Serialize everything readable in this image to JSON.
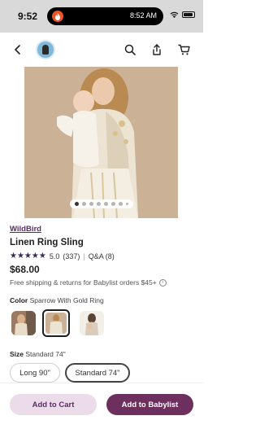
{
  "status_bar": {
    "time": "9:52",
    "island_time": "8:52 AM"
  },
  "product": {
    "brand": "WildBird",
    "title": "Linen Ring Sling",
    "rating_value": "5.0",
    "rating_count": "(337)",
    "qa_label": "Q&A (8)",
    "price": "$68.00",
    "shipping_text": "Free shipping & returns for Babylist orders $45+"
  },
  "color_option": {
    "label": "Color",
    "selected_value": "Sparrow With Gold Ring"
  },
  "size_option": {
    "label": "Size",
    "selected_value": "Standard 74\"",
    "options": [
      "Long 90\"",
      "Standard 74\""
    ]
  },
  "actions": {
    "add_to_cart": "Add to Cart",
    "add_to_registry": "Add to Babylist"
  },
  "colors": {
    "brand": "#5b2b6b",
    "primary_button": "#6c2f5e",
    "secondary_button": "#ecdcea",
    "stars": "#3b2a55"
  },
  "icons": {
    "back": "chevron-left-icon",
    "search": "search-icon",
    "share": "share-icon",
    "cart": "cart-icon",
    "info": "info-icon"
  }
}
